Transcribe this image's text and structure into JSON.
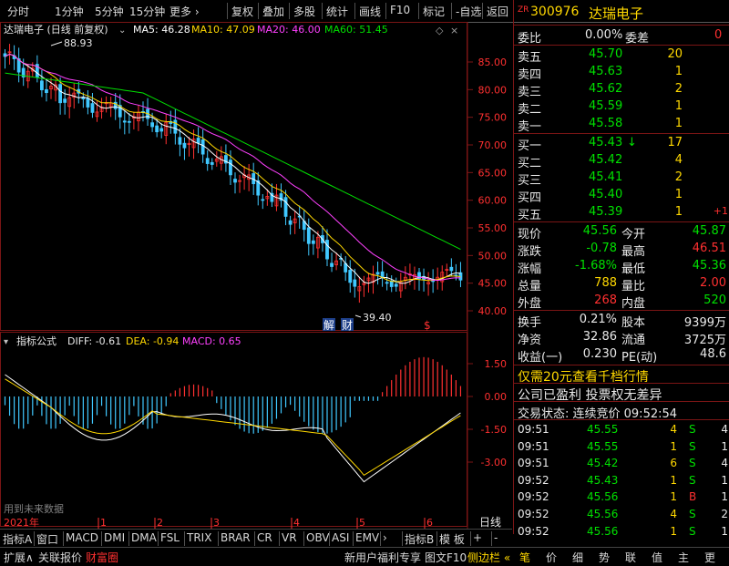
{
  "toolbar": {
    "left": [
      "分时",
      "1分钟",
      "5分钟",
      "15分钟",
      "更多 ›"
    ],
    "right": [
      "复权",
      "叠加",
      "多股",
      "统计",
      "画线",
      "F10",
      "标记",
      "-自选",
      "返回"
    ]
  },
  "main": {
    "title": "达瑞电子 (日线 前复权)",
    "ma": [
      {
        "label": "MA5: 46.28",
        "color": "#ffffff"
      },
      {
        "label": "MA10: 47.09",
        "color": "#ffd800"
      },
      {
        "label": "MA20: 46.00",
        "color": "#ff40ff"
      },
      {
        "label": "MA60: 51.45",
        "color": "#00e000"
      }
    ],
    "high_mark": "88.93",
    "low_mark": "39.40",
    "icons": [
      "解",
      "财"
    ],
    "price_ticks": [
      "85.00",
      "80.00",
      "75.00",
      "70.00",
      "65.00",
      "60.00",
      "55.00",
      "50.00",
      "45.00",
      "40.00"
    ]
  },
  "indicator": {
    "name": "指标公式",
    "diff": "DIFF: -0.61",
    "dea": "DEA: -0.94",
    "macd": "MACD: 0.65",
    "ticks": [
      "1.50",
      "0.00",
      "-1.50",
      "-3.00"
    ],
    "footnote": "用到未来数据"
  },
  "time_axis": {
    "year": "2021年",
    "months": [
      "1",
      "2",
      "3",
      "4",
      "5",
      "6"
    ],
    "right_label": "日线"
  },
  "bottom_tabs": [
    "指标A",
    "窗口",
    "MACD",
    "DMI",
    "DMA",
    "FSL",
    "TRIX",
    "BRAR",
    "CR",
    "VR",
    "OBV",
    "ASI",
    "EMV",
    "›",
    "指标B",
    "模 板",
    "+",
    "-"
  ],
  "status_bar": {
    "left": [
      "扩展∧",
      "关联报价",
      "财富圈"
    ],
    "mid": [
      "新用户福利专享",
      "图文F10",
      "侧边栏 «"
    ],
    "right": [
      "笔",
      "价",
      "细",
      "势",
      "联",
      "值",
      "主",
      "更"
    ]
  },
  "quote": {
    "prefix": "ZR",
    "code": "300976",
    "name": "达瑞电子",
    "weibi_label": "委比",
    "weibi_value": "0.00%",
    "weicha_label": "委差",
    "weicha_value": "0",
    "asks": [
      {
        "label": "卖五",
        "price": "45.70",
        "vol": "20"
      },
      {
        "label": "卖四",
        "price": "45.63",
        "vol": "1"
      },
      {
        "label": "卖三",
        "price": "45.62",
        "vol": "2"
      },
      {
        "label": "卖二",
        "price": "45.59",
        "vol": "1"
      },
      {
        "label": "卖一",
        "price": "45.58",
        "vol": "1"
      }
    ],
    "bids": [
      {
        "label": "买一",
        "price": "45.43",
        "arrow": "↓",
        "vol": "17",
        "chg": ""
      },
      {
        "label": "买二",
        "price": "45.42",
        "arrow": "",
        "vol": "4",
        "chg": ""
      },
      {
        "label": "买三",
        "price": "45.41",
        "arrow": "",
        "vol": "2",
        "chg": ""
      },
      {
        "label": "买四",
        "price": "45.40",
        "arrow": "",
        "vol": "1",
        "chg": ""
      },
      {
        "label": "买五",
        "price": "45.39",
        "arrow": "",
        "vol": "1",
        "chg": "+1"
      }
    ],
    "stats": [
      {
        "l1": "现价",
        "v1": "45.56",
        "c1": "green",
        "l2": "今开",
        "v2": "45.87",
        "c2": "green"
      },
      {
        "l1": "涨跌",
        "v1": "-0.78",
        "c1": "green",
        "l2": "最高",
        "v2": "46.51",
        "c2": "red"
      },
      {
        "l1": "涨幅",
        "v1": "-1.68%",
        "c1": "green",
        "l2": "最低",
        "v2": "45.36",
        "c2": "green"
      },
      {
        "l1": "总量",
        "v1": "788",
        "c1": "yellow",
        "l2": "量比",
        "v2": "2.00",
        "c2": "red"
      },
      {
        "l1": "外盘",
        "v1": "268",
        "c1": "red",
        "l2": "内盘",
        "v2": "520",
        "c2": "green"
      }
    ],
    "stats2": [
      {
        "l1": "换手",
        "v1": "0.21%",
        "l2": "股本",
        "v2": "9399万"
      },
      {
        "l1": "净资",
        "v1": "32.86",
        "l2": "流通",
        "v2": "3725万"
      },
      {
        "l1": "收益(一)",
        "v1": "0.230",
        "l2": "PE(动)",
        "v2": "48.6"
      }
    ],
    "promo": "仅需20元查看千档行情",
    "promo_highlight": "20",
    "company_info": "公司已盈利 投票权无差异",
    "trade_status": "交易状态: 连续竞价 09:52:54",
    "ticks": [
      {
        "time": "09:51",
        "price": "45.55",
        "vol": "4",
        "bs": "S",
        "n": "4"
      },
      {
        "time": "09:51",
        "price": "45.55",
        "vol": "1",
        "bs": "S",
        "n": "1"
      },
      {
        "time": "09:51",
        "price": "45.42",
        "vol": "6",
        "bs": "S",
        "n": "4"
      },
      {
        "time": "09:52",
        "price": "45.43",
        "vol": "1",
        "bs": "S",
        "n": "1"
      },
      {
        "time": "09:52",
        "price": "45.56",
        "vol": "1",
        "bs": "B",
        "n": "1"
      },
      {
        "time": "09:52",
        "price": "45.56",
        "vol": "4",
        "bs": "S",
        "n": "2"
      },
      {
        "time": "09:52",
        "price": "45.56",
        "vol": "1",
        "bs": "S",
        "n": "1"
      }
    ]
  },
  "colors": {
    "up": "#ff3030",
    "down": "#00e000",
    "frame": "#7a1515",
    "macd_pos": "#ff3030",
    "macd_neg": "#40c8ff"
  }
}
